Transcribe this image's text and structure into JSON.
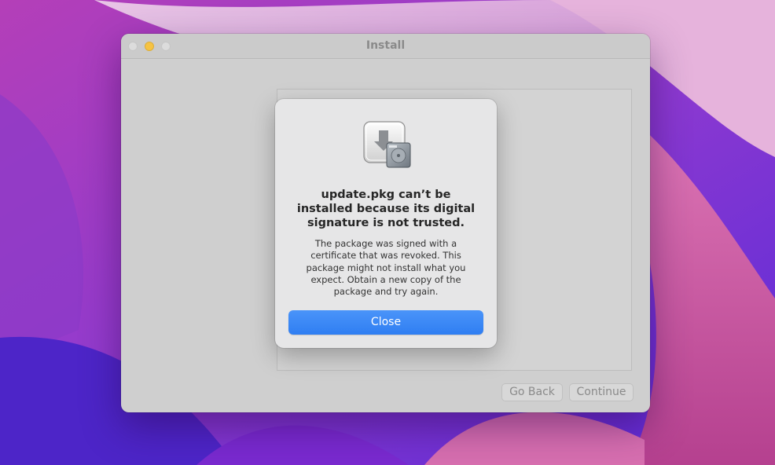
{
  "window": {
    "title": "Install",
    "controls": [
      "close",
      "minimize",
      "zoom"
    ]
  },
  "footer": {
    "back_label": "Go Back",
    "continue_label": "Continue"
  },
  "dialog": {
    "icon": "installer-package-icon",
    "title": "update.pkg can’t be installed because its digital signature is not trusted.",
    "message": "The package was signed with a certificate that was revoked. This package might not install what you expect. Obtain a new copy of the package and try again.",
    "close_label": "Close"
  },
  "colors": {
    "accent": "#3a86f5",
    "minimize": "#f6c342",
    "desktop": "#7a3fb0"
  }
}
